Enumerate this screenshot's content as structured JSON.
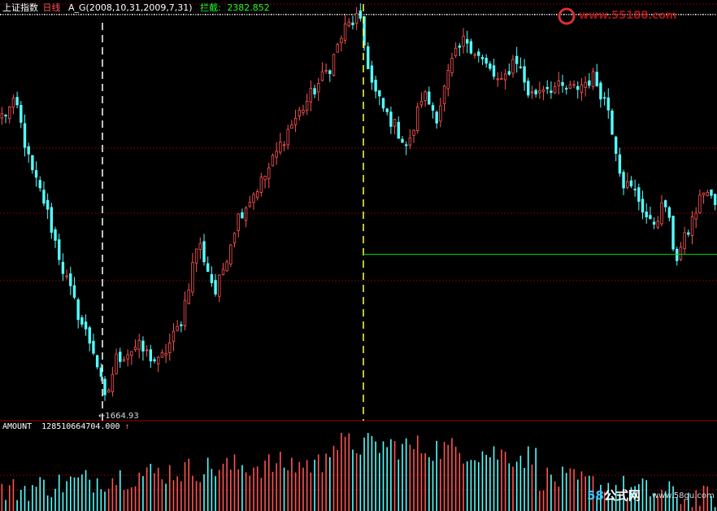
{
  "header": {
    "index_name": "上证指数",
    "period": "日线",
    "formula": "A_G(2008,10,31,2009,7,31)",
    "value_label": "拦截:",
    "value": "2382.852"
  },
  "volume_header": {
    "label": "AMOUNT",
    "value": "128510664704.000",
    "arrow": "↑"
  },
  "watermark_top": "www.55188.com",
  "watermark_bottom": {
    "num": "58",
    "cn": "公式网",
    "url": "www.58gu.com"
  },
  "colors": {
    "up": "#ff5454",
    "down": "#54ffff",
    "grid": "#7a0000",
    "marker": "#ffff54",
    "hline": "#00e000",
    "title_red": "#ff5454",
    "title_green": "#20ff20"
  },
  "chart_data": {
    "type": "candlestick",
    "low_label": "1664.93",
    "low_value": 1664.93,
    "intercept_value": 2382.852,
    "price_range": [
      1650,
      3480
    ],
    "trend": [
      [
        0,
        3020
      ],
      [
        0.02,
        3080
      ],
      [
        0.04,
        2780
      ],
      [
        0.06,
        2620
      ],
      [
        0.085,
        2320
      ],
      [
        0.11,
        2080
      ],
      [
        0.13,
        1930
      ],
      [
        0.145,
        1700
      ],
      [
        0.16,
        1900
      ],
      [
        0.19,
        1960
      ],
      [
        0.22,
        1880
      ],
      [
        0.25,
        2060
      ],
      [
        0.275,
        2450
      ],
      [
        0.3,
        2200
      ],
      [
        0.33,
        2550
      ],
      [
        0.37,
        2750
      ],
      [
        0.4,
        2950
      ],
      [
        0.43,
        3100
      ],
      [
        0.46,
        3250
      ],
      [
        0.48,
        3420
      ],
      [
        0.5,
        3480
      ],
      [
        0.52,
        3150
      ],
      [
        0.535,
        3050
      ],
      [
        0.55,
        2980
      ],
      [
        0.57,
        2870
      ],
      [
        0.59,
        3130
      ],
      [
        0.61,
        3020
      ],
      [
        0.63,
        3260
      ],
      [
        0.65,
        3380
      ],
      [
        0.67,
        3290
      ],
      [
        0.7,
        3160
      ],
      [
        0.72,
        3300
      ],
      [
        0.74,
        3110
      ],
      [
        0.76,
        3160
      ],
      [
        0.8,
        3140
      ],
      [
        0.83,
        3200
      ],
      [
        0.85,
        3060
      ],
      [
        0.87,
        2720
      ],
      [
        0.89,
        2660
      ],
      [
        0.91,
        2510
      ],
      [
        0.93,
        2620
      ],
      [
        0.945,
        2360
      ],
      [
        0.96,
        2470
      ],
      [
        0.985,
        2690
      ],
      [
        1.0,
        2610
      ]
    ]
  }
}
